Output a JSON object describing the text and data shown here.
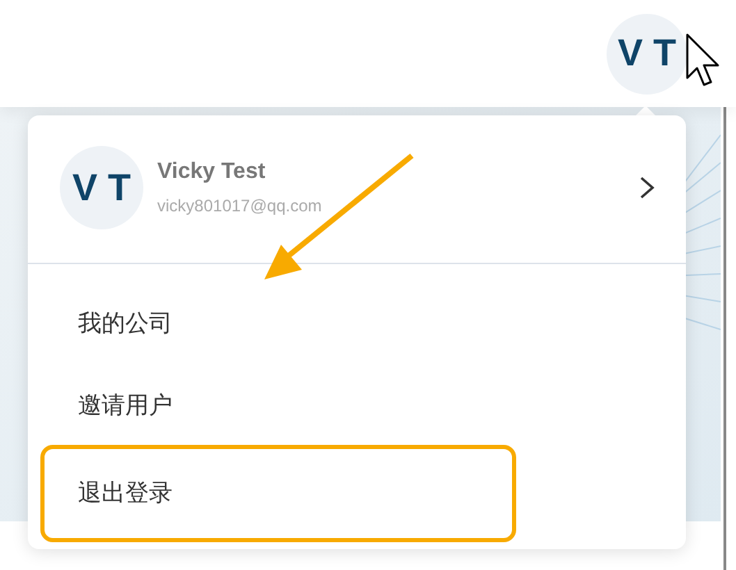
{
  "topbar": {
    "avatar_initials": "V T"
  },
  "user_menu": {
    "avatar_initials": "V T",
    "name": "Vicky Test",
    "email": "vicky801017@qq.com",
    "items": [
      {
        "label": "我的公司",
        "highlighted": false
      },
      {
        "label": "邀请用户",
        "highlighted": false
      },
      {
        "label": "退出登录",
        "highlighted": true
      }
    ]
  }
}
